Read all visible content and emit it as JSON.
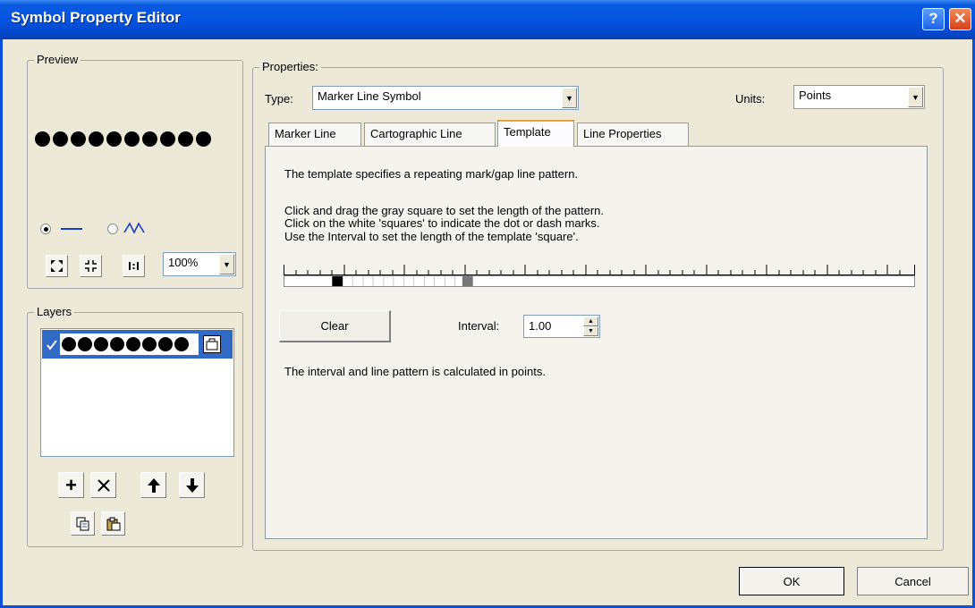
{
  "window": {
    "title": "Symbol Property Editor",
    "help_label": "?",
    "close_label": "✕"
  },
  "preview": {
    "legend": "Preview",
    "zoom": "100%"
  },
  "layers": {
    "legend": "Layers"
  },
  "properties": {
    "legend": "Properties:",
    "type_label": "Type:",
    "type_value": "Marker Line Symbol",
    "units_label": "Units:",
    "units_value": "Points"
  },
  "tabs": [
    {
      "label": "Marker Line"
    },
    {
      "label": "Cartographic Line"
    },
    {
      "label": "Template"
    },
    {
      "label": "Line Properties"
    }
  ],
  "template_panel": {
    "intro": "The template specifies a repeating mark/gap line pattern.",
    "instr1": "Click and drag the gray square to set the length of the pattern.",
    "instr2": "Click on the white 'squares' to indicate the dot or dash marks.",
    "instr3": "Use the Interval to set the length of the template 'square'.",
    "clear_label": "Clear",
    "interval_label": "Interval:",
    "interval_value": "1.00",
    "footer": "The interval and line pattern is calculated in points."
  },
  "buttons": {
    "ok": "OK",
    "cancel": "Cancel"
  }
}
